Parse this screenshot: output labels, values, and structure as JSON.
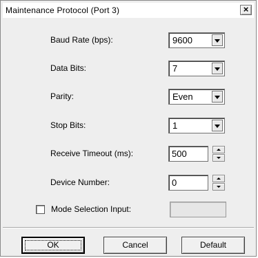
{
  "window": {
    "title": "Maintenance Protocol (Port 3)",
    "close_glyph": "×"
  },
  "fields": {
    "baud_rate": {
      "label": "Baud Rate (bps):",
      "value": "9600"
    },
    "data_bits": {
      "label": "Data Bits:",
      "value": "7"
    },
    "parity": {
      "label": "Parity:",
      "value": "Even"
    },
    "stop_bits": {
      "label": "Stop Bits:",
      "value": "1"
    },
    "receive_timeout": {
      "label": "Receive Timeout (ms):",
      "value": "500"
    },
    "device_number": {
      "label": "Device Number:",
      "value": "0"
    },
    "mode_selection": {
      "label": "Mode Selection Input:",
      "checked": false,
      "value": ""
    }
  },
  "buttons": {
    "ok": "OK",
    "cancel": "Cancel",
    "default": "Default"
  }
}
